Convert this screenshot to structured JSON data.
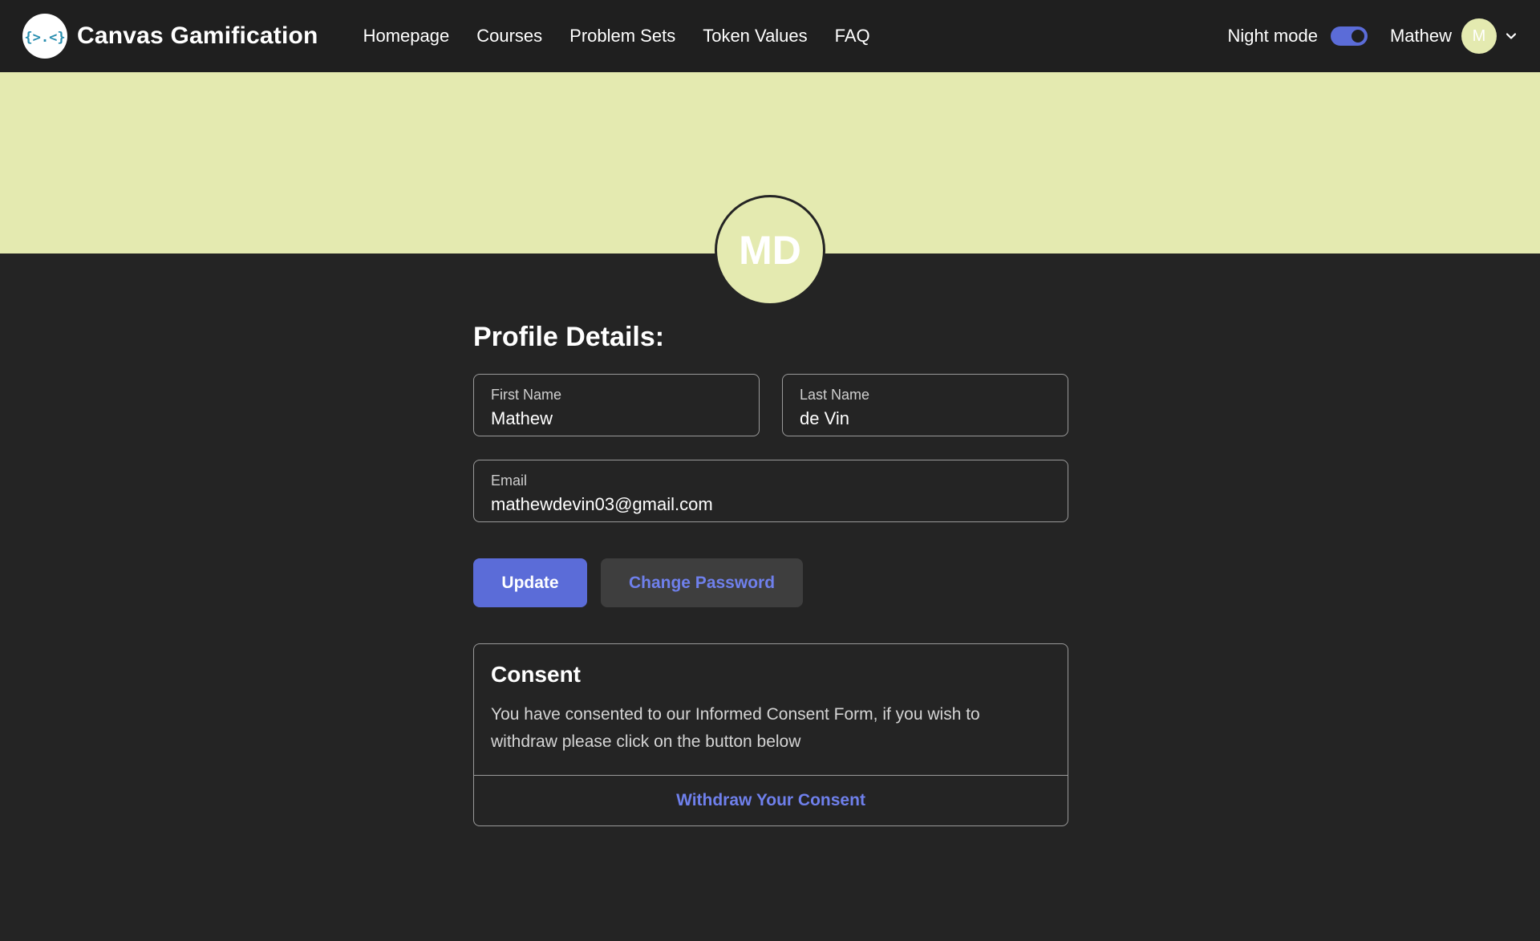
{
  "app": {
    "brand_name": "Canvas Gamification",
    "logo_glyph": "{>.<}"
  },
  "nav": {
    "links": [
      {
        "label": "Homepage"
      },
      {
        "label": "Courses"
      },
      {
        "label": "Problem Sets"
      },
      {
        "label": "Token Values"
      },
      {
        "label": "FAQ"
      }
    ],
    "night_mode_label": "Night mode",
    "night_mode_on": true,
    "user_name": "Mathew",
    "user_initial": "M"
  },
  "profile": {
    "avatar_initials": "MD",
    "section_title": "Profile Details:",
    "first_name": {
      "label": "First Name",
      "value": "Mathew"
    },
    "last_name": {
      "label": "Last Name",
      "value": "de Vin"
    },
    "email": {
      "label": "Email",
      "value": "mathewdevin03@gmail.com"
    },
    "update_label": "Update",
    "change_password_label": "Change Password"
  },
  "consent": {
    "title": "Consent",
    "text": "You have consented to our Informed Consent Form, if you wish to withdraw please click on the button below",
    "withdraw_label": "Withdraw Your Consent"
  },
  "colors": {
    "accent": "#5b6cd8",
    "accent_text": "#6f80ec",
    "banner": "#e4eab0",
    "background": "#242424",
    "navbar": "#1f1f1f"
  }
}
